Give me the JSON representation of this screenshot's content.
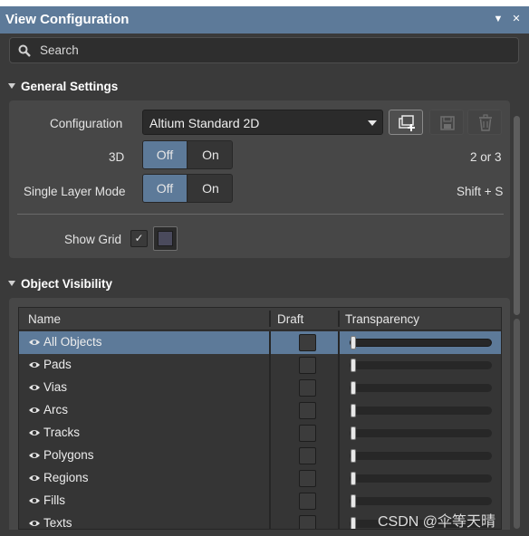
{
  "window": {
    "title": "View Configuration"
  },
  "search": {
    "placeholder": "Search"
  },
  "general_settings": {
    "heading": "General Settings",
    "configuration_label": "Configuration",
    "configuration_value": "Altium Standard 2D",
    "threed_label": "3D",
    "threed_shortcut": "2 or 3",
    "single_layer_label": "Single Layer Mode",
    "single_layer_shortcut": "Shift + S",
    "show_grid_label": "Show Grid",
    "toggle_off": "Off",
    "toggle_on": "On",
    "show_grid_checked": true
  },
  "object_visibility": {
    "heading": "Object Visibility",
    "columns": [
      "Name",
      "Draft",
      "Transparency"
    ],
    "rows": [
      {
        "name": "All Objects",
        "selected": true
      },
      {
        "name": "Pads"
      },
      {
        "name": "Vias"
      },
      {
        "name": "Arcs"
      },
      {
        "name": "Tracks"
      },
      {
        "name": "Polygons"
      },
      {
        "name": "Regions"
      },
      {
        "name": "Fills"
      },
      {
        "name": "Texts"
      }
    ]
  },
  "watermark": "CSDN @伞等天晴",
  "colors": {
    "accent": "#5d7a99",
    "panel_bg": "#3a3a3a",
    "section_bg": "#474747"
  },
  "icons": [
    "search-icon",
    "add-configuration-icon",
    "save-icon",
    "delete-icon",
    "eye-icon",
    "pin-icon",
    "close-icon",
    "checkmark-icon"
  ]
}
